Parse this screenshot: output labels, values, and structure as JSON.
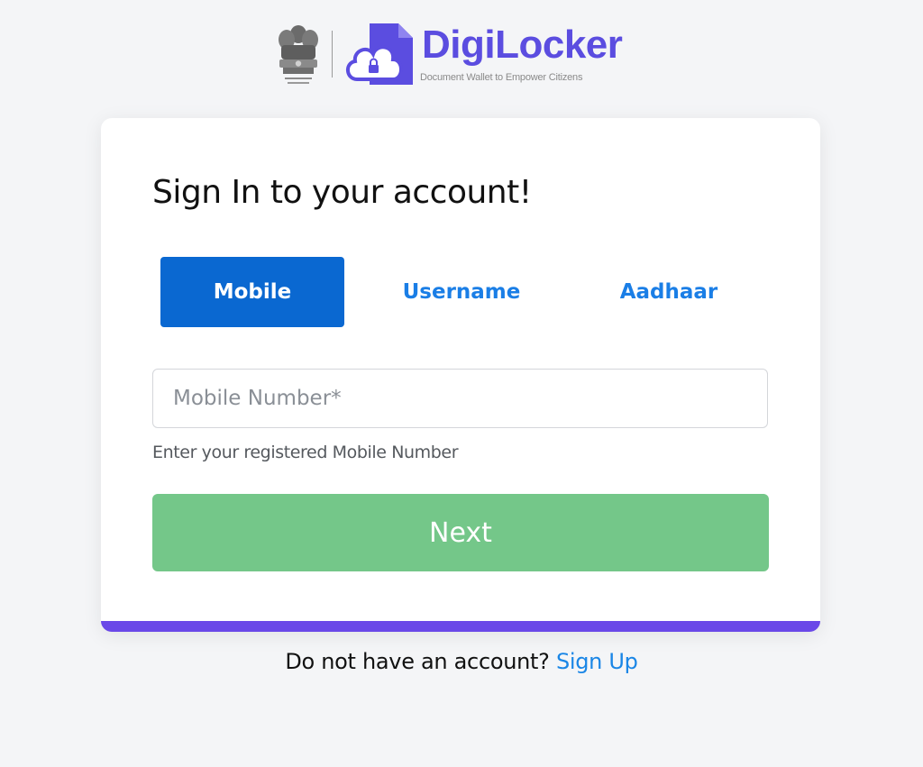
{
  "header": {
    "brand_name": "DigiLocker",
    "tagline": "Document Wallet to Empower Citizens",
    "emblem_icon": "state-emblem-icon",
    "logo_icon": "cloud-document-lock-icon"
  },
  "login_card": {
    "title": "Sign In to your account!",
    "tabs": [
      {
        "label": "Mobile",
        "active": true
      },
      {
        "label": "Username",
        "active": false
      },
      {
        "label": "Aadhaar",
        "active": false
      }
    ],
    "mobile_input": {
      "value": "",
      "placeholder": "Mobile Number*"
    },
    "helper_text": "Enter your registered Mobile Number",
    "next_label": "Next"
  },
  "footer": {
    "prompt": "Do not have an account? ",
    "signup_label": "Sign Up"
  },
  "colors": {
    "brand": "#5b4de0",
    "active_tab": "#0a68d1",
    "tab_text": "#1a7ee6",
    "next_button": "#74c789",
    "card_accent": "#6a48e8",
    "link": "#1a86e6"
  }
}
